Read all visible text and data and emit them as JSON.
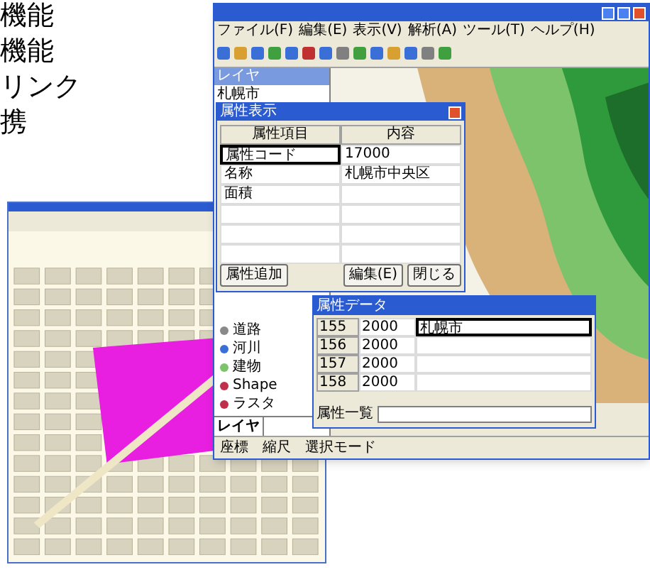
{
  "caption_lines": [
    "機能",
    "機能",
    "リンク",
    "携"
  ],
  "main_window": {
    "menu": [
      "ファイル(F)",
      "編集(E)",
      "表示(V)",
      "解析(A)",
      "ツール(T)",
      "ヘルプ(H)"
    ],
    "layer_panel": {
      "title": "レイヤ",
      "items": [
        {
          "label": "札幌市"
        }
      ],
      "lower_items": [
        {
          "label": "道路",
          "color": "#8a8a8a"
        },
        {
          "label": "河川",
          "color": "#3a6fd8"
        },
        {
          "label": "建物",
          "color": "#7cc36b"
        },
        {
          "label": "Shape",
          "color": "#c0304a"
        },
        {
          "label": "ラスタ",
          "color": "#c0304a"
        }
      ],
      "tabs": [
        {
          "label": "レイヤ",
          "selected": true
        }
      ]
    },
    "attribute_dialog": {
      "title": "属性表示",
      "columns": [
        "属性項目",
        "内容"
      ],
      "rows": [
        {
          "item": "属性コード",
          "value": "17000",
          "selected": true
        },
        {
          "item": "名称",
          "value": "札幌市中央区",
          "selected": false
        },
        {
          "item": "面積",
          "selected": false
        },
        {
          "selected": false
        },
        {
          "selected": false
        },
        {
          "selected": false
        }
      ],
      "buttons": [
        "属性追加",
        "編集(E)",
        "閉じる"
      ]
    },
    "table_dialog": {
      "title": "属性データ",
      "rows": [
        {
          "id": "155",
          "year": "2000",
          "name": "札幌市",
          "selected": true
        },
        {
          "id": "156",
          "year": "2000",
          "selected": false
        },
        {
          "id": "157",
          "year": "2000",
          "selected": false
        },
        {
          "id": "158",
          "year": "2000",
          "selected": false
        }
      ],
      "footer_label": "属性一覧"
    },
    "status_bar": [
      "座標",
      "縮尺",
      "選択モード"
    ]
  }
}
